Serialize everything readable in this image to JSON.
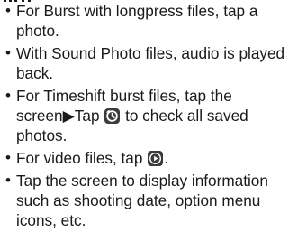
{
  "notes": {
    "items": [
      {
        "text": "For Burst with longpress files, tap a photo."
      },
      {
        "text": "With Sound Photo files, audio is played back."
      },
      {
        "before": "For Timeshift burst files, tap the screen▶Tap ",
        "after": " to check all saved photos."
      },
      {
        "before": "For video files, tap ",
        "after": "."
      },
      {
        "text": "Tap the screen to display information such as shooting date, option menu icons, etc."
      }
    ],
    "bullet": "•"
  },
  "icons": {
    "timeshift": "timeshift-clock-icon",
    "play": "video-play-icon"
  },
  "colors": {
    "text": "#1a1a1a",
    "icon_bg": "#3b3b3b"
  }
}
